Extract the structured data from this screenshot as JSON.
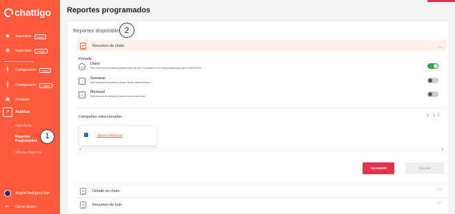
{
  "app": {
    "logo_text": "chattigo"
  },
  "sidebar": {
    "items": [
      {
        "icon": "eye-icon",
        "label": "Supervisor",
        "badge": "Nuevo"
      },
      {
        "icon": "eye-icon",
        "label": "Supervisor",
        "badge": "Legacy"
      },
      {
        "icon": "sliders-icon",
        "label": "Configuración",
        "badge": "Nuevo"
      },
      {
        "icon": "sliders-icon",
        "label": "Configuración",
        "badge": "Legacy"
      },
      {
        "icon": "shopping-icon",
        "label": "Compras",
        "badge": ""
      },
      {
        "icon": "analytics-icon",
        "label": "Analítica",
        "badge": ""
      }
    ],
    "subitems": [
      "Reportería",
      "Reportes\nProgramados",
      "Últimos Reportes"
    ],
    "user_name": "Angela Rodriguez Sup",
    "logout_label": "Cerrar Sesión"
  },
  "annotations": {
    "one": "1",
    "two": "2"
  },
  "main": {
    "title": "Reportes programados",
    "card_title": "Reportes disponibles",
    "accordions": [
      {
        "label": "Resumen de chats",
        "expanded": true
      },
      {
        "label": "Detalle de chats",
        "expanded": false
      },
      {
        "label": "Resumen de bots",
        "expanded": false
      }
    ],
    "periodo_label": "Periodo",
    "periods": [
      {
        "icon": "clock-24-icon",
        "icon_text": "24",
        "title": "Diario",
        "desc": "Este reporte se enviará a primera hora del día. El próximo envío está programado para el 28/07/2020",
        "enabled": true
      },
      {
        "icon": "calendar-week-icon",
        "icon_text": "",
        "title": "Semanal",
        "desc": "Este reporte se enviará el primer día de cada semana.",
        "enabled": false
      },
      {
        "icon": "calendar-month-icon",
        "icon_text": "31",
        "title": "Mensual",
        "desc": "Este reporte se enviará el primer día de cada mes.",
        "enabled": false
      }
    ],
    "campaigns_title": "Campañas seleccionadas",
    "pager_page": "1",
    "campaigns": [
      {
        "name": "#Demo Multicanal",
        "checked": true
      }
    ],
    "save_label": "GUARDAR",
    "cancel_label": "Cancelar"
  },
  "colors": {
    "brand": "#fe5a3c",
    "save": "#e0334d",
    "toggle_on": "#28a745",
    "checkbox": "#1565c0"
  }
}
